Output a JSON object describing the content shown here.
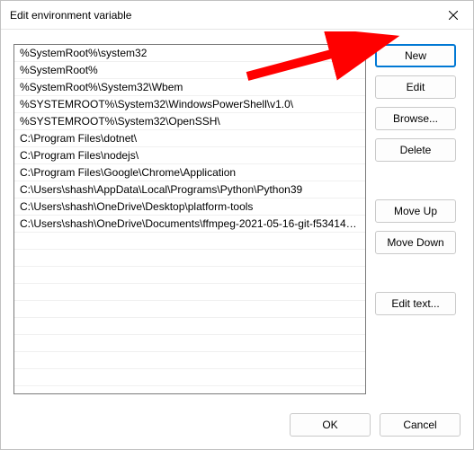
{
  "title": "Edit environment variable",
  "entries": [
    "%SystemRoot%\\system32",
    "%SystemRoot%",
    "%SystemRoot%\\System32\\Wbem",
    "%SYSTEMROOT%\\System32\\WindowsPowerShell\\v1.0\\",
    "%SYSTEMROOT%\\System32\\OpenSSH\\",
    "C:\\Program Files\\dotnet\\",
    "C:\\Program Files\\nodejs\\",
    "C:\\Program Files\\Google\\Chrome\\Application",
    "C:\\Users\\shash\\AppData\\Local\\Programs\\Python\\Python39",
    "C:\\Users\\shash\\OneDrive\\Desktop\\platform-tools",
    "C:\\Users\\shash\\OneDrive\\Documents\\ffmpeg-2021-05-16-git-f53414a..."
  ],
  "buttons": {
    "new": "New",
    "edit": "Edit",
    "browse": "Browse...",
    "delete": "Delete",
    "moveUp": "Move Up",
    "moveDown": "Move Down",
    "editText": "Edit text...",
    "ok": "OK",
    "cancel": "Cancel"
  },
  "annotation": {
    "arrow_color": "#ff0000",
    "arrow_target": "new-button"
  }
}
